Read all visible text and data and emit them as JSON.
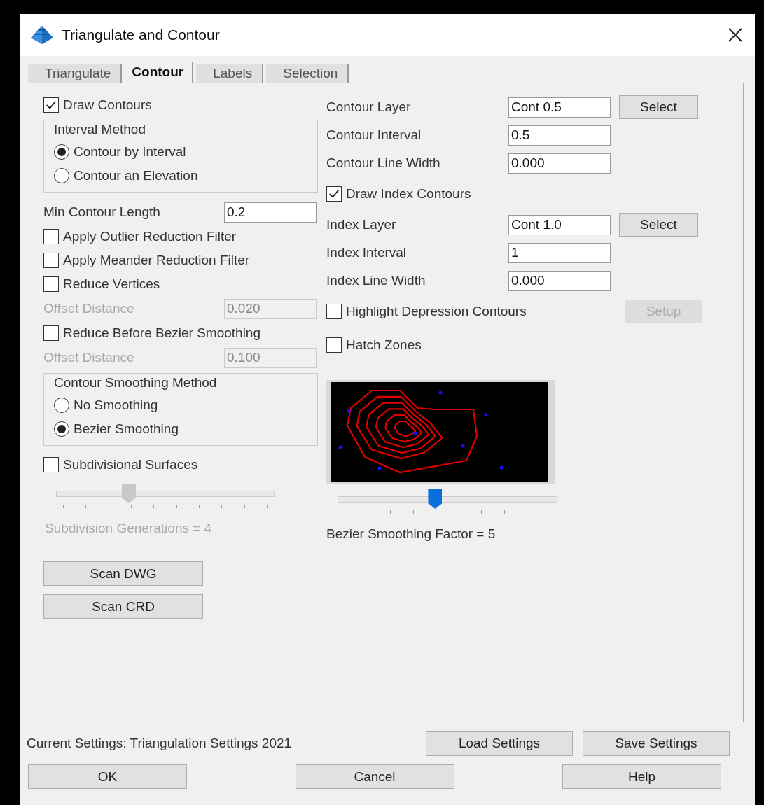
{
  "window": {
    "title": "Triangulate and Contour"
  },
  "tabs": [
    {
      "label": "Triangulate",
      "selected": false
    },
    {
      "label": "Contour",
      "selected": true
    },
    {
      "label": "Labels",
      "selected": false
    },
    {
      "label": "Selection",
      "selected": false
    }
  ],
  "left_rows": [
    {
      "kind": "checkbox",
      "label": "Draw Contours",
      "checked": true
    },
    {
      "kind": "group",
      "title": "Interval Method",
      "options": [
        {
          "label": "Contour by Interval",
          "selected": true
        },
        {
          "label": "Contour an Elevation",
          "selected": false
        }
      ]
    },
    {
      "kind": "field",
      "label": "Min Contour Length",
      "value": "0.2",
      "disabled": false
    },
    {
      "kind": "checkbox",
      "label": "Apply Outlier Reduction Filter",
      "checked": false
    },
    {
      "kind": "checkbox",
      "label": "Apply Meander Reduction Filter",
      "checked": false
    },
    {
      "kind": "checkbox",
      "label": "Reduce Vertices",
      "checked": false
    },
    {
      "kind": "field",
      "label": "Offset Distance",
      "value": "0.020",
      "disabled": true
    },
    {
      "kind": "checkbox",
      "label": "Reduce Before Bezier Smoothing",
      "checked": false
    },
    {
      "kind": "field",
      "label": "Offset Distance",
      "value": "0.100",
      "disabled": true
    },
    {
      "kind": "group",
      "title": "Contour Smoothing Method",
      "options": [
        {
          "label": "No Smoothing",
          "selected": false
        },
        {
          "label": "Bezier Smoothing",
          "selected": true
        }
      ]
    },
    {
      "kind": "checkbox",
      "label": "Subdivisional Surfaces",
      "checked": false
    },
    {
      "kind": "slider",
      "level": 0.333,
      "reading": "Subdivision Generations = 4",
      "disabled": true
    },
    {
      "kind": "button",
      "label": "Scan DWG"
    },
    {
      "kind": "button",
      "label": "Scan CRD"
    }
  ],
  "right_rows": [
    {
      "kind": "field",
      "label": "Contour Layer",
      "value": "Cont 0.5",
      "button": {
        "label": "Select",
        "disabled": false
      }
    },
    {
      "kind": "field",
      "label": "Contour Interval",
      "value": "0.5"
    },
    {
      "kind": "field",
      "label": "Contour Line Width",
      "value": "0.000"
    },
    {
      "kind": "checkbox",
      "label": "Draw Index Contours",
      "checked": true
    },
    {
      "kind": "field",
      "label": "Index Layer",
      "value": "Cont 1.0",
      "button": {
        "label": "Select",
        "disabled": false
      }
    },
    {
      "kind": "field",
      "label": "Index Interval",
      "value": "1"
    },
    {
      "kind": "field",
      "label": "Index Line Width",
      "value": "0.000"
    },
    {
      "kind": "checkbox",
      "label": "Highlight Depression Contours",
      "checked": false,
      "button": {
        "label": "Setup",
        "disabled": true
      }
    },
    {
      "kind": "checkbox",
      "label": "Hatch Zones",
      "checked": false
    }
  ],
  "smoothing_slider": {
    "level": 0.444,
    "reading": "Bezier Smoothing Factor = 5",
    "disabled": false
  },
  "current_settings": "Current Settings: Triangulation Settings 2021",
  "settings_buttons": [
    "Load Settings",
    "Save Settings"
  ],
  "buttons": [
    "OK",
    "Cancel",
    "Help"
  ]
}
